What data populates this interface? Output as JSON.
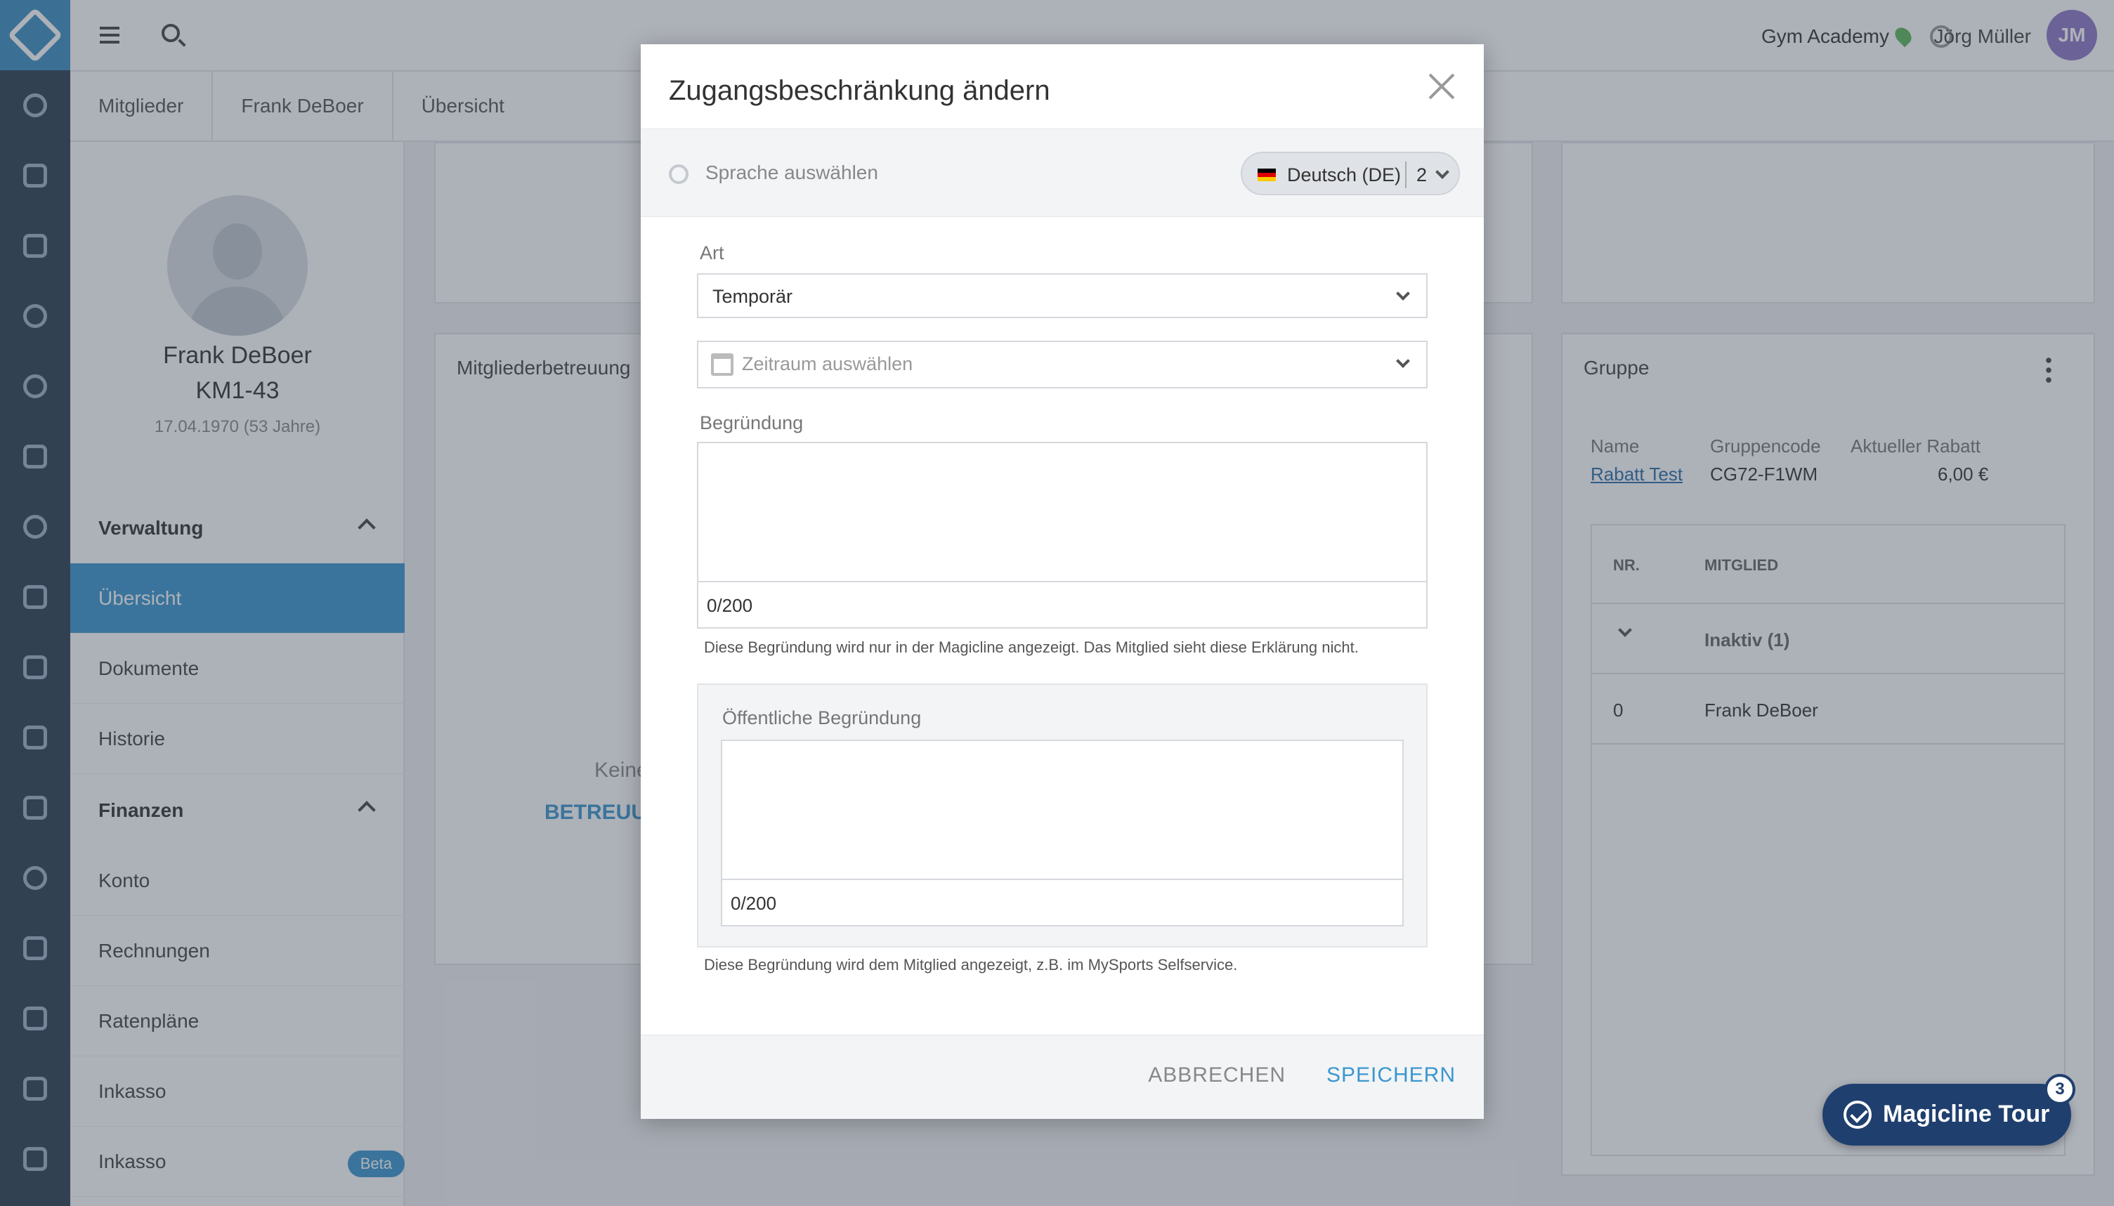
{
  "topbar": {
    "studio": "Gym Academy",
    "user_name": "Jörg Müller",
    "user_initials": "JM"
  },
  "breadcrumb": [
    "Mitglieder",
    "Frank DeBoer",
    "Übersicht"
  ],
  "member": {
    "name": "Frank DeBoer",
    "id": "KM1-43",
    "dob": "17.04.1970 (53 Jahre)"
  },
  "sidebar": {
    "verwaltung_label": "Verwaltung",
    "verwaltung_items": [
      "Übersicht",
      "Dokumente",
      "Historie"
    ],
    "finanzen_label": "Finanzen",
    "finanzen_items": [
      "Konto",
      "Rechnungen",
      "Ratenpläne",
      "Inkasso",
      "Inkasso"
    ],
    "beta_label": "Beta"
  },
  "cards": {
    "betreuung_title": "Mitgliederbetreuung",
    "betreuung_empty": "Keine",
    "betreuung_action": "BETREUUN",
    "group_title": "Gruppe",
    "group_headers": [
      "Name",
      "Gruppencode",
      "Aktueller Rabatt"
    ],
    "group_values": [
      "Rabatt Test",
      "CG72-F1WM",
      "6,00 €"
    ],
    "table_headers": [
      "NR.",
      "MITGLIED"
    ],
    "inactive_label": "Inaktiv (1)",
    "row": [
      "0",
      "Frank DeBoer"
    ]
  },
  "modal": {
    "title": "Zugangsbeschränkung ändern",
    "lang_label": "Sprache auswählen",
    "lang_value": "Deutsch (DE)",
    "lang_count": "2",
    "art_label": "Art",
    "art_value": "Temporär",
    "zeitraum_placeholder": "Zeitraum auswählen",
    "begruendung_label": "Begründung",
    "begruendung_counter": "0/200",
    "begruendung_hint": "Diese Begründung wird nur in der Magicline angezeigt. Das Mitglied sieht diese Erklärung nicht.",
    "public_label": "Öffentliche Begründung",
    "public_counter": "0/200",
    "public_hint": "Diese Begründung wird dem Mitglied angezeigt, z.B. im MySports Selfservice.",
    "cancel": "ABBRECHEN",
    "save": "SPEICHERN"
  },
  "tour": {
    "label": "Magicline Tour",
    "badge": "3"
  }
}
